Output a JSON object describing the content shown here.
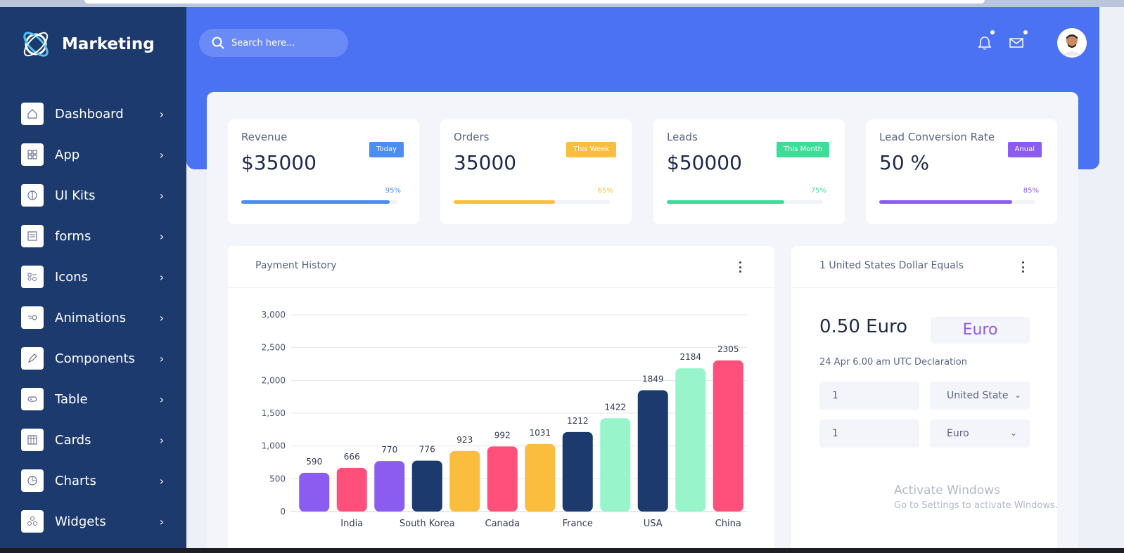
{
  "brand": {
    "name": "Marketing"
  },
  "sidebar": {
    "items": [
      {
        "label": "Dashboard",
        "icon": "home-icon"
      },
      {
        "label": "App",
        "icon": "grid-icon"
      },
      {
        "label": "UI Kits",
        "icon": "palette-icon"
      },
      {
        "label": "forms",
        "icon": "form-icon"
      },
      {
        "label": "Icons",
        "icon": "icons-icon"
      },
      {
        "label": "Animations",
        "icon": "animation-icon"
      },
      {
        "label": "Components",
        "icon": "pen-icon"
      },
      {
        "label": "Table",
        "icon": "table-icon"
      },
      {
        "label": "Cards",
        "icon": "cards-icon"
      },
      {
        "label": "Charts",
        "icon": "chart-icon"
      },
      {
        "label": "Widgets",
        "icon": "widgets-icon"
      }
    ]
  },
  "search": {
    "placeholder": "Search here..."
  },
  "stats": [
    {
      "title": "Revenue",
      "value": "$35000",
      "badge": "Today",
      "percent": "95%",
      "progress": 0.95,
      "color": "#4b8df0"
    },
    {
      "title": "Orders",
      "value": "35000",
      "badge": "This Week",
      "percent": "65%",
      "progress": 0.65,
      "color": "#fbbd3d"
    },
    {
      "title": "Leads",
      "value": "$50000",
      "badge": "This Month",
      "percent": "75%",
      "progress": 0.75,
      "color": "#3ddc97"
    },
    {
      "title": "Lead Conversion Rate",
      "value": "50 %",
      "badge": "Anual",
      "percent": "85%",
      "progress": 0.85,
      "color": "#8c5cf0"
    }
  ],
  "payment_history": {
    "title": "Payment History"
  },
  "converter": {
    "title": "1 United States Dollar Equals",
    "value": "0.50 Euro",
    "currency": "Euro",
    "note": "24 Apr 6.00 am UTC Declaration",
    "from_amount": "1",
    "from_currency": "United State",
    "to_amount": "1",
    "to_currency": "Euro"
  },
  "watermark": {
    "line1": "Activate Windows",
    "line2": "Go to Settings to activate Windows."
  },
  "chart_data": {
    "type": "bar",
    "title": "Payment History",
    "values": [
      590,
      666,
      770,
      776,
      923,
      992,
      1031,
      1212,
      1422,
      1849,
      2184,
      2305
    ],
    "colors": [
      "#8c5cf0",
      "#ff4f7b",
      "#8c5cf0",
      "#1c3a6e",
      "#fbbd3d",
      "#ff4f7b",
      "#fbbd3d",
      "#1c3a6e",
      "#98f5cb",
      "#1c3a6e",
      "#98f5cb",
      "#ff4f7b"
    ],
    "x_labels": [
      "",
      "India",
      "",
      "South Korea",
      "",
      "Canada",
      "",
      "France",
      "",
      "USA",
      "",
      "China"
    ],
    "y_ticks": [
      "0",
      "500",
      "1,000",
      "1,500",
      "2,000",
      "2,500",
      "3,000"
    ],
    "ylim": [
      0,
      3000
    ],
    "grid": true
  }
}
